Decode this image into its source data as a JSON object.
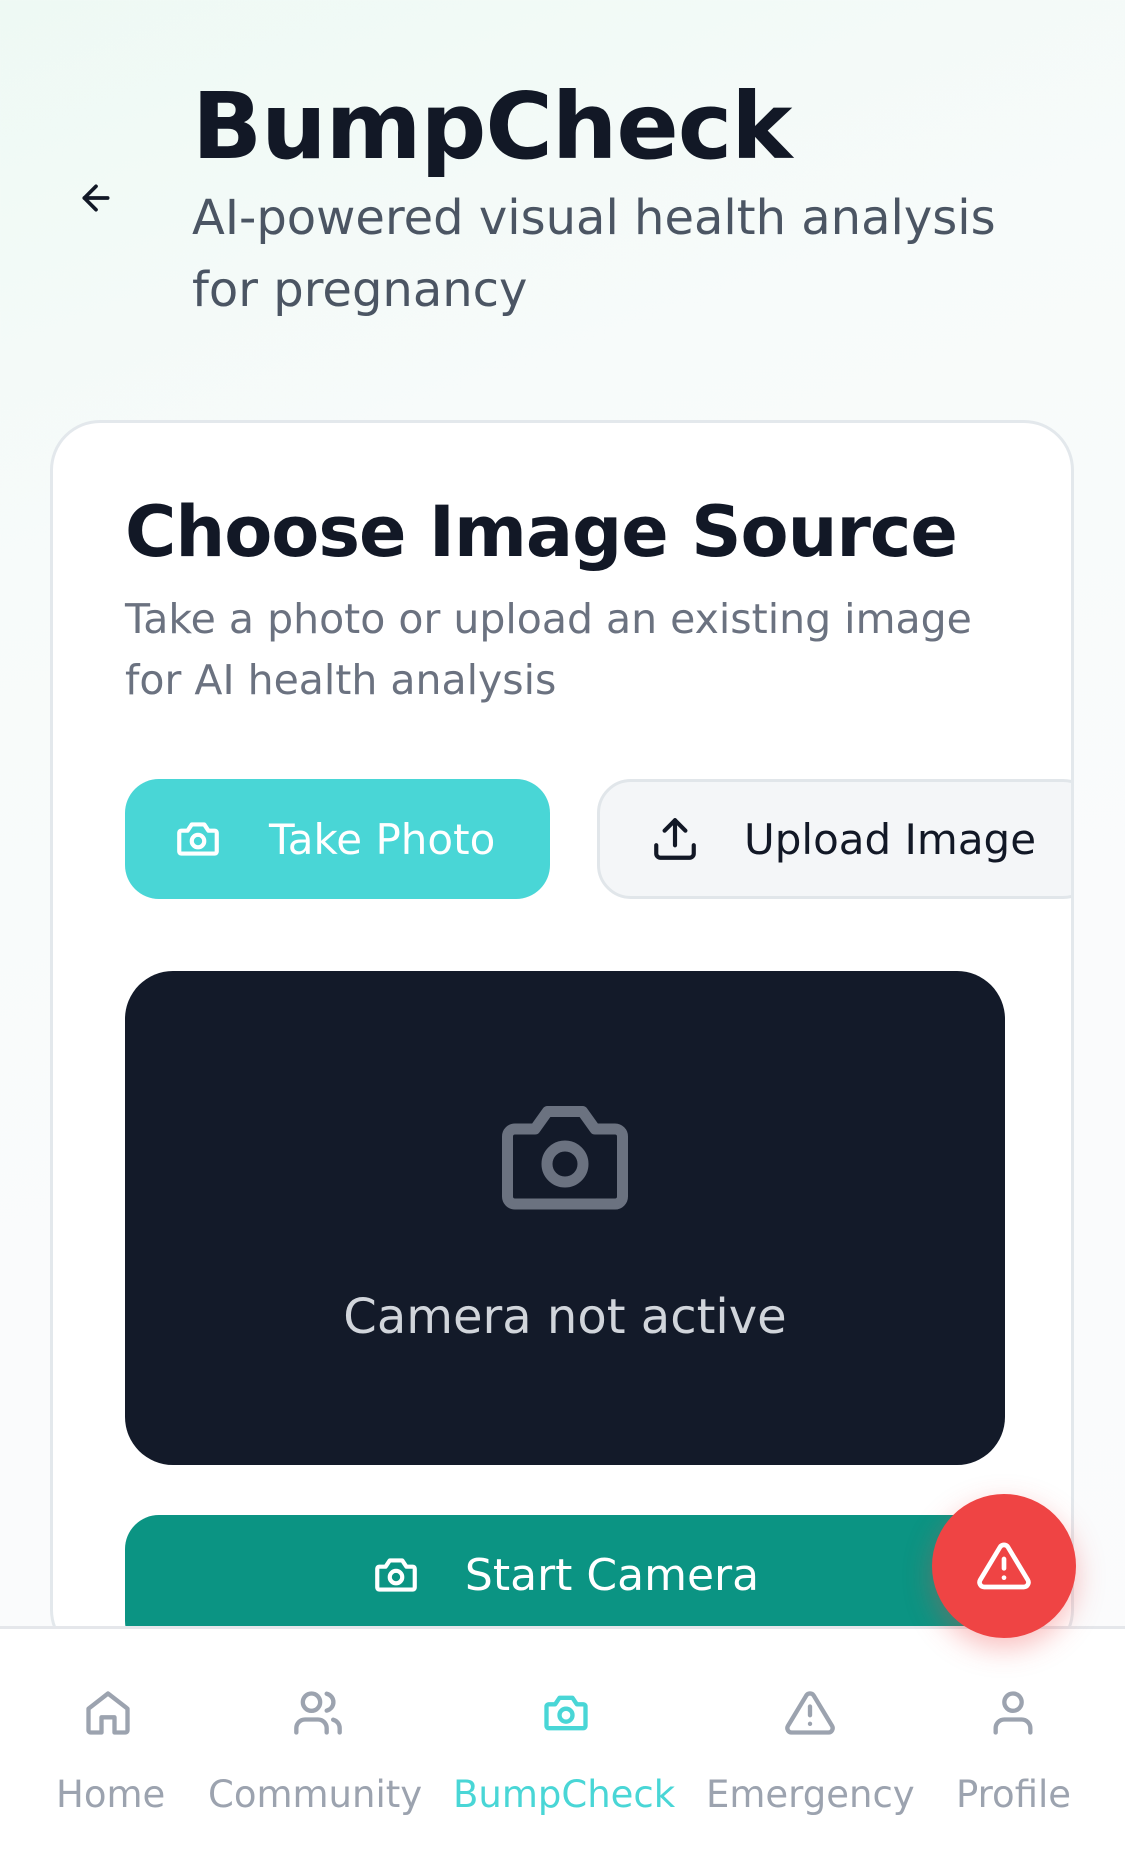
{
  "header": {
    "back_icon": "arrow-left-icon",
    "title": "BumpCheck",
    "subtitle": "AI-powered visual health analysis for pregnancy"
  },
  "card": {
    "title": "Choose Image Source",
    "description": "Take a photo or upload an existing image for AI health analysis",
    "take_photo_label": "Take Photo",
    "take_photo_icon": "camera-icon",
    "upload_label": "Upload Image",
    "upload_icon": "upload-icon",
    "camera_status": "Camera not active",
    "camera_placeholder_icon": "camera-icon",
    "start_camera_label": "Start Camera",
    "start_camera_icon": "camera-icon"
  },
  "fab": {
    "icon": "alert-triangle-icon"
  },
  "nav": {
    "items": [
      {
        "label": "Home",
        "icon": "home-icon",
        "active": false
      },
      {
        "label": "Community",
        "icon": "users-icon",
        "active": false
      },
      {
        "label": "BumpCheck",
        "icon": "camera-icon",
        "active": true
      },
      {
        "label": "Emergency",
        "icon": "alert-triangle-icon",
        "active": false
      },
      {
        "label": "Profile",
        "icon": "user-icon",
        "active": false
      }
    ]
  },
  "colors": {
    "accent": "#49d6d6",
    "primary_dark": "#0b9483",
    "camera_bg": "#131a29",
    "emergency": "#ef4444",
    "title": "#121826",
    "muted": "#9ca3af"
  }
}
